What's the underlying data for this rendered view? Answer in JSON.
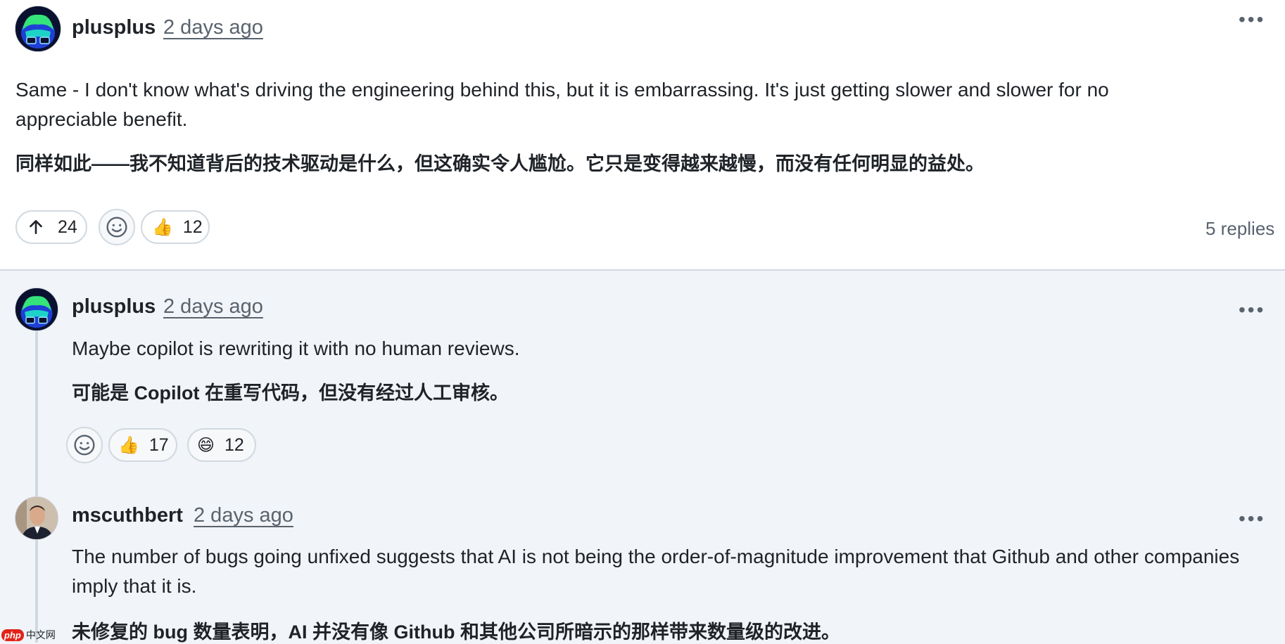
{
  "comment": {
    "author": "plusplus",
    "time": "2 days ago",
    "body": "Same - I don't know what's driving the engineering behind this, but it is embarrassing. It's just getting slower and slower for no appreciable benefit.",
    "translation": "同样如此——我不知道背后的技术驱动是什么，但这确实令人尴尬。它只是变得越来越慢，而没有任何明显的益处。",
    "upvotes": "24",
    "reactions": [
      {
        "icon": "thumbs-up-icon",
        "emoji": "👍",
        "count": "12"
      }
    ],
    "replies_label": "5 replies"
  },
  "replies": [
    {
      "author": "plusplus",
      "time": "2 days ago",
      "body": "Maybe copilot is rewriting it with no human reviews.",
      "translation": "可能是 Copilot 在重写代码，但没有经过人工审核。",
      "reactions": [
        {
          "icon": "thumbs-up-icon",
          "emoji": "👍",
          "count": "17"
        },
        {
          "icon": "laugh-icon",
          "emoji": "😄",
          "count": "12"
        }
      ]
    },
    {
      "author": "mscuthbert",
      "time": "2 days ago",
      "body": "The number of bugs going unfixed suggests that AI is not being the order-of-magnitude improvement that Github and other companies imply that it is.",
      "translation": "未修复的 bug 数量表明，AI 并没有像 Github 和其他公司所暗示的那样带来数量级的改进。"
    }
  ],
  "watermark": {
    "logo": "php",
    "text": "中文网"
  },
  "colors": {
    "border": "#d1d9e0",
    "muted": "#59636e",
    "reply_bg": "#f1f4f8",
    "watermark_red": "#e2231a"
  }
}
